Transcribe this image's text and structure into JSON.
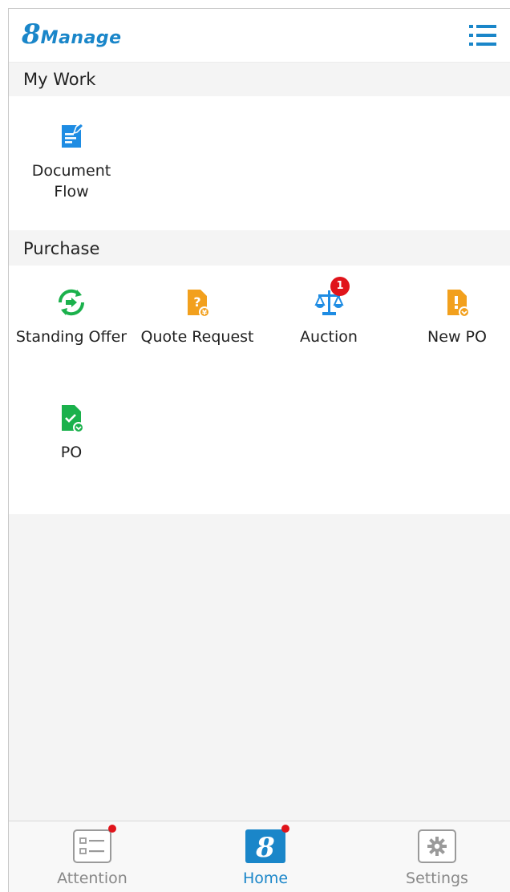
{
  "app": {
    "logo_digit": "8",
    "logo_word": "Manage",
    "brand_color": "#1a86c9"
  },
  "header": {
    "menu_icon": "list-menu-icon"
  },
  "sections": {
    "my_work": {
      "title": "My Work",
      "tiles": [
        {
          "label": "Document\nFlow",
          "icon": "document-edit-icon"
        }
      ]
    },
    "purchase": {
      "title": "Purchase",
      "tiles": [
        {
          "label": "Standing Offer",
          "icon": "standing-offer-icon"
        },
        {
          "label": "Quote Request",
          "icon": "quote-request-icon"
        },
        {
          "label": "Auction",
          "icon": "scales-icon",
          "badge": "1"
        },
        {
          "label": "New PO",
          "icon": "new-po-icon"
        },
        {
          "label": "PO",
          "icon": "po-document-icon"
        }
      ]
    }
  },
  "bottom_nav": {
    "tabs": [
      {
        "label": "Attention",
        "icon": "checklist-icon",
        "notification": true
      },
      {
        "label": "Home",
        "icon": "home-8-icon",
        "active": true,
        "notification": true,
        "glyph": "8"
      },
      {
        "label": "Settings",
        "icon": "gear-icon"
      }
    ]
  },
  "colors": {
    "orange": "#f2a01d",
    "green": "#1bb14c",
    "blue": "#1e8ce3",
    "badge_red": "#e0141b"
  }
}
